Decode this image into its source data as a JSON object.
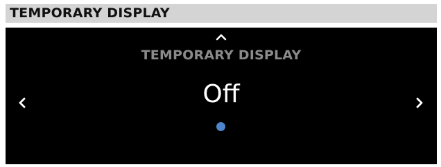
{
  "header": {
    "title": "TEMPORARY DISPLAY"
  },
  "screen": {
    "title": "TEMPORARY DISPLAY",
    "value": "Off",
    "icons": {
      "up": "chevron-up-icon",
      "left": "chevron-left-icon",
      "right": "chevron-right-icon"
    },
    "page_indicator": {
      "total_pages": 1,
      "active_index": 0
    },
    "colors": {
      "background": "#000000",
      "title": "#8a8a8a",
      "value": "#ffffff",
      "indicator": "#4d86cc"
    }
  }
}
